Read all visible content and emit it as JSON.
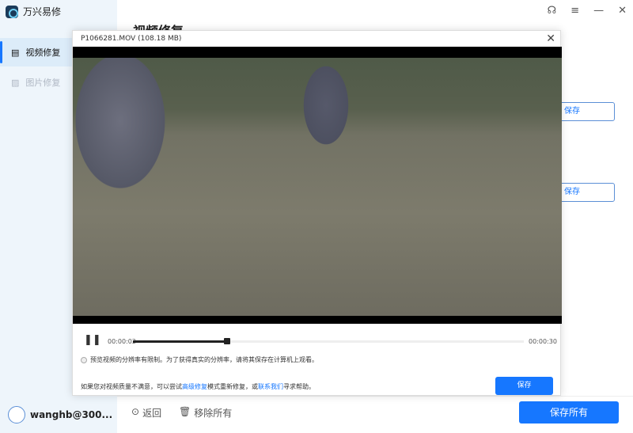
{
  "app": {
    "name": "万兴易修"
  },
  "sidebar": {
    "items": [
      {
        "label": "视频修复"
      },
      {
        "label": "图片修复"
      }
    ],
    "user": "wanghb@300..."
  },
  "background": {
    "title": "视频修复",
    "save_labels": [
      "保存",
      "保存"
    ]
  },
  "footer": {
    "back": "返回",
    "remove_all": "移除所有",
    "save_all": "保存所有"
  },
  "modal": {
    "title": "P1066281.MOV (108.18  MB)",
    "current_time": "00:00:02",
    "total_time": "00:00:30",
    "progress_percent": 24,
    "note": "预览视频的分辨率有限制。为了获得真实的分辨率，请将其保存在计算机上观看。",
    "help_prefix": "如果您对视频质量不满意，可以尝试",
    "help_link1": "高级修复",
    "help_mid": "模式重新修复，或",
    "help_link2": "联系我们",
    "help_suffix": "寻求帮助。",
    "save": "保存"
  }
}
